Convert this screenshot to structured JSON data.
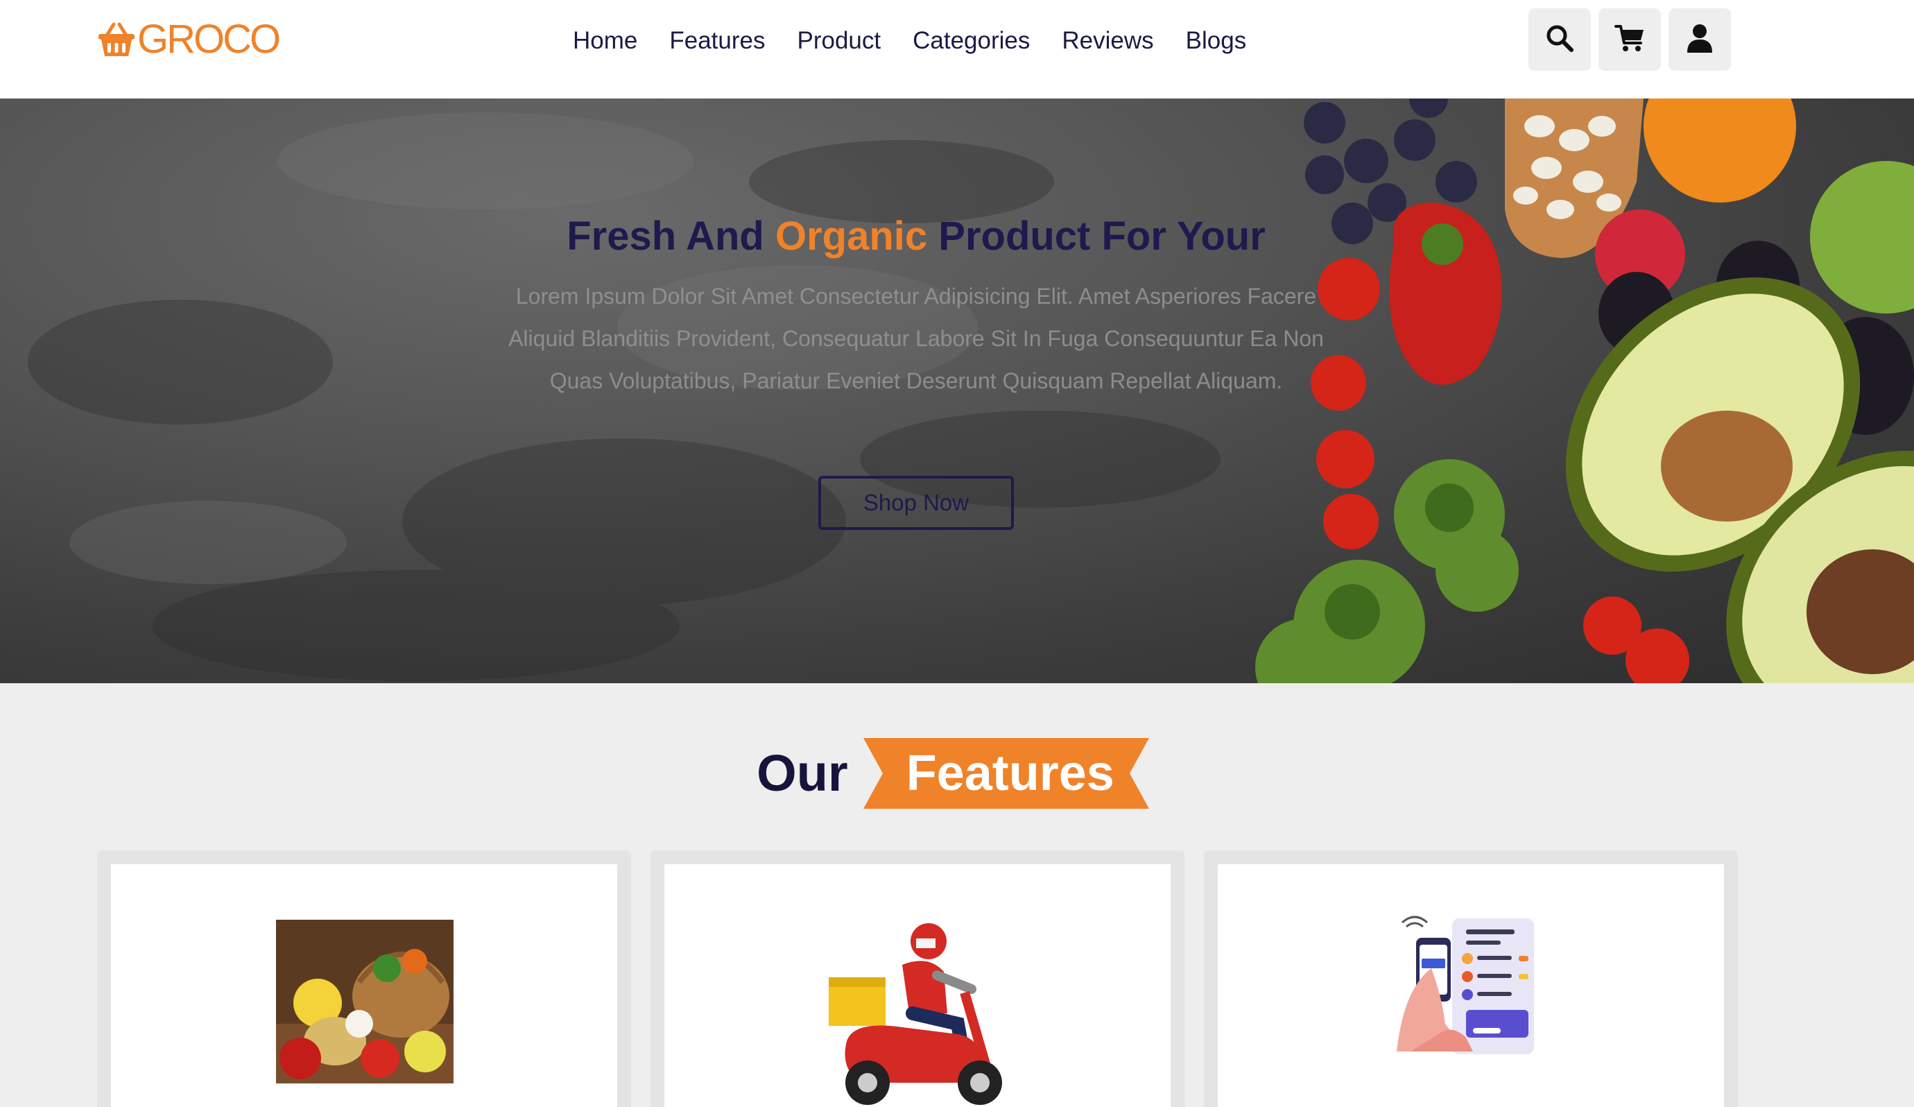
{
  "brand": {
    "name": "GROCO",
    "icon": "basket-icon",
    "color": "#f0822a"
  },
  "nav": {
    "items": [
      {
        "label": "Home"
      },
      {
        "label": "Features"
      },
      {
        "label": "Product"
      },
      {
        "label": "Categories"
      },
      {
        "label": "Reviews"
      },
      {
        "label": "Blogs"
      }
    ]
  },
  "header_actions": [
    {
      "icon": "search-icon"
    },
    {
      "icon": "cart-icon"
    },
    {
      "icon": "user-icon"
    }
  ],
  "hero": {
    "title_part1": "Fresh And ",
    "title_accent": "Organic",
    "title_part2": " Product For Your",
    "description": "Lorem Ipsum Dolor Sit Amet Consectetur Adipisicing Elit. Amet Asperiores Facere Aliquid Blanditiis Provident, Consequatur Labore Sit In Fuga Consequuntur Ea Non Quas Voluptatibus, Pariatur Eveniet Deserunt Quisquam Repellat Aliquam.",
    "button_label": "Shop Now",
    "accent_color": "#f0822a",
    "title_color": "#1d1a4d"
  },
  "features": {
    "heading_plain": "Our",
    "heading_highlight": "Features",
    "cards": [
      {
        "image": "fruit-basket-image"
      },
      {
        "image": "delivery-scooter-image"
      },
      {
        "image": "mobile-payment-image"
      }
    ]
  }
}
